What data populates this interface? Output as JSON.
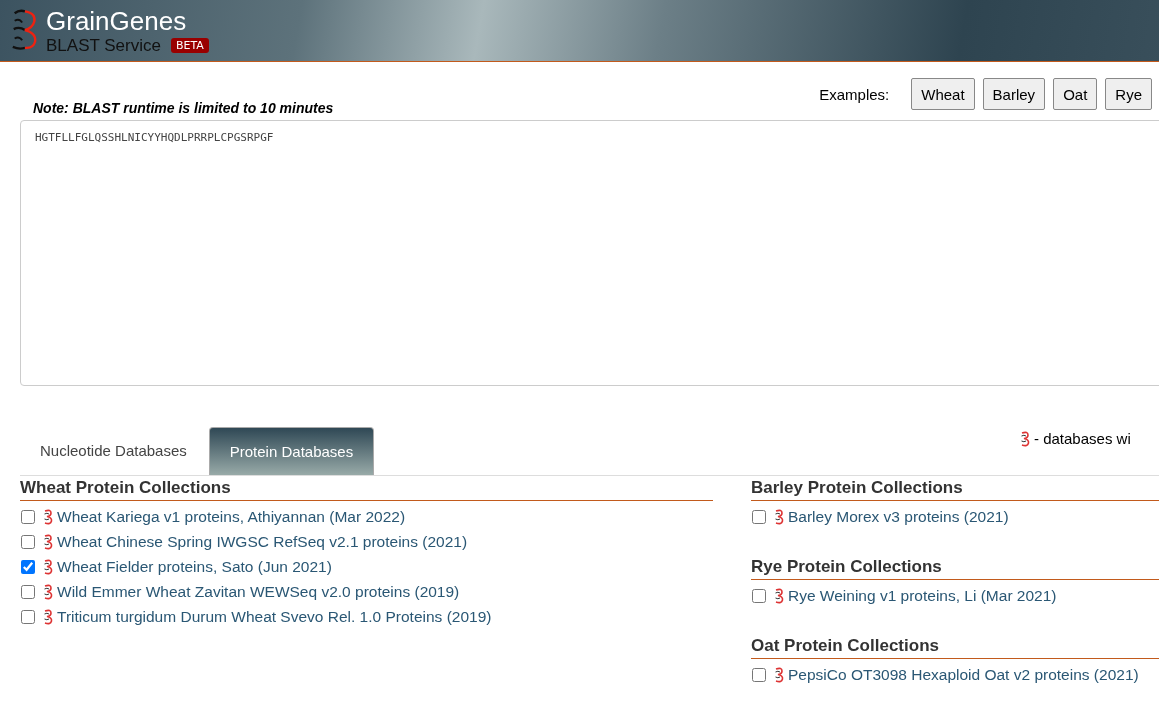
{
  "header": {
    "title": "GrainGenes",
    "subtitle": "BLAST Service",
    "badge": "BETA"
  },
  "note": "Note: BLAST runtime is limited to 10 minutes",
  "examples": {
    "label": "Examples:",
    "buttons": [
      "Wheat",
      "Barley",
      "Oat",
      "Rye"
    ]
  },
  "sequence": {
    "value": "HGTFLLFGLQSSHLNICYYHQDLPRRPLCPGSRPGF"
  },
  "tabs": [
    {
      "label": "Nucleotide Databases",
      "selected": false
    },
    {
      "label": "Protein Databases",
      "selected": true
    }
  ],
  "legend": {
    "text": "- databases wi"
  },
  "columns": [
    {
      "sections": [
        {
          "title": "Wheat Protein Collections",
          "items": [
            {
              "label": "Wheat Kariega v1 proteins, Athiyannan (Mar 2022)",
              "checked": false
            },
            {
              "label": "Wheat Chinese Spring IWGSC RefSeq v2.1 proteins (2021)",
              "checked": false
            },
            {
              "label": "Wheat Fielder proteins, Sato (Jun 2021)",
              "checked": true
            },
            {
              "label": "Wild Emmer Wheat Zavitan WEWSeq v2.0 proteins (2019)",
              "checked": false
            },
            {
              "label": "Triticum turgidum Durum Wheat Svevo Rel. 1.0 Proteins (2019)",
              "checked": false
            }
          ]
        }
      ]
    },
    {
      "sections": [
        {
          "title": "Barley Protein Collections",
          "items": [
            {
              "label": "Barley Morex v3 proteins (2021)",
              "checked": false
            }
          ]
        },
        {
          "title": "Rye Protein Collections",
          "items": [
            {
              "label": "Rye Weining v1 proteins, Li (Mar 2021)",
              "checked": false
            }
          ]
        },
        {
          "title": "Oat Protein Collections",
          "items": [
            {
              "label": "PepsiCo OT3098 Hexaploid Oat v2 proteins (2021)",
              "checked": false
            }
          ]
        }
      ]
    }
  ]
}
